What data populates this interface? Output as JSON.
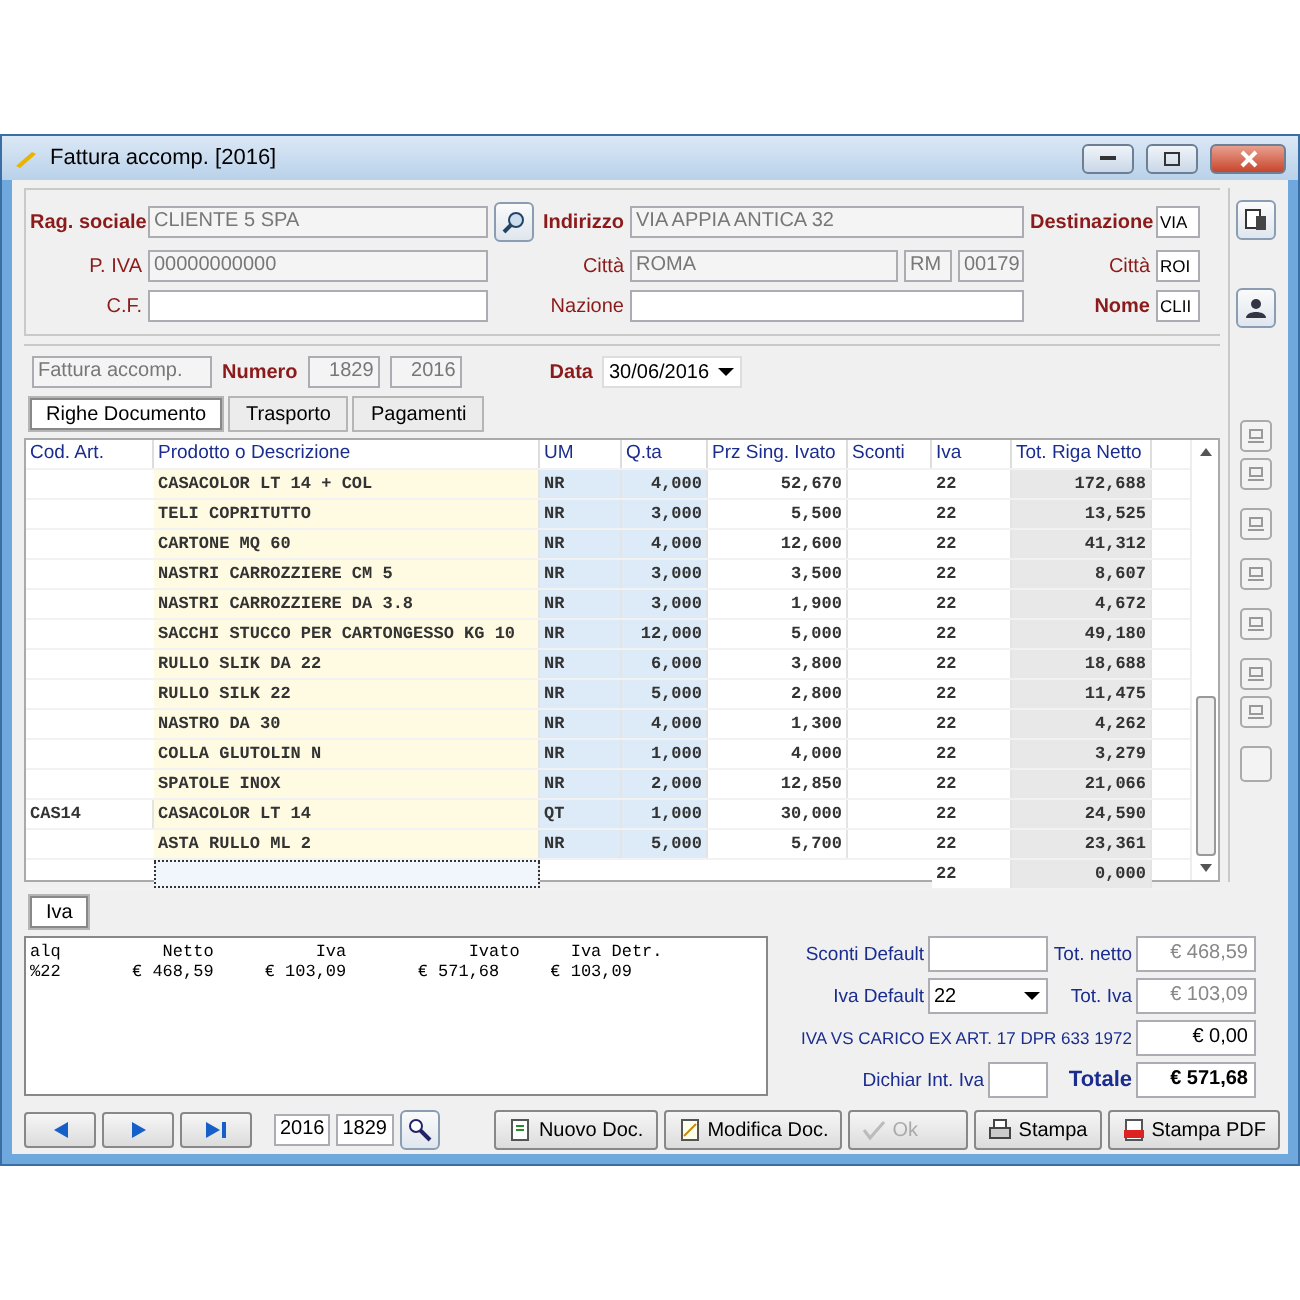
{
  "window": {
    "title": "Fattura accomp. [2016]"
  },
  "customer": {
    "ragione_label": "Rag. sociale",
    "ragione": "CLIENTE 5 SPA",
    "piva_label": "P. IVA",
    "piva": "00000000000",
    "cf_label": "C.F.",
    "indirizzo_label": "Indirizzo",
    "indirizzo": "VIA APPIA ANTICA 32",
    "citta_label": "Città",
    "citta": "ROMA",
    "prov": "RM",
    "cap": "00179",
    "nazione_label": "Nazione",
    "dest_label": "Destinazione",
    "dest": "VIA",
    "dest_citta_label": "Città",
    "dest_citta": "ROI",
    "nome_label": "Nome",
    "nome": "CLII"
  },
  "document": {
    "type": "Fattura accomp.",
    "numero_label": "Numero",
    "numero": "1829",
    "anno": "2016",
    "data_label": "Data",
    "data": "30/06/2016"
  },
  "tabs": [
    {
      "label": "Righe Documento",
      "selected": true
    },
    {
      "label": "Trasporto",
      "selected": false
    },
    {
      "label": "Pagamenti",
      "selected": false
    }
  ],
  "table": {
    "columns": [
      "Cod. Art.",
      "Prodotto o Descrizione",
      "UM",
      "Q.ta",
      "Prz Sing. Ivato",
      "Sconti",
      "Iva",
      "Tot. Riga Netto"
    ],
    "rows": [
      {
        "cells": [
          "",
          "CASACOLOR LT 14 + COL",
          "NR",
          "4,000",
          "52,670",
          "",
          "22",
          "172,688"
        ],
        "current": false
      },
      {
        "cells": [
          "",
          "TELI COPRITUTTO",
          "NR",
          "3,000",
          "5,500",
          "",
          "22",
          "13,525"
        ],
        "current": false
      },
      {
        "cells": [
          "",
          "CARTONE MQ 60",
          "NR",
          "4,000",
          "12,600",
          "",
          "22",
          "41,312"
        ],
        "current": false
      },
      {
        "cells": [
          "",
          "NASTRI CARROZZIERE CM 5",
          "NR",
          "3,000",
          "3,500",
          "",
          "22",
          "8,607"
        ],
        "current": false
      },
      {
        "cells": [
          "",
          "NASTRI CARROZZIERE DA 3.8",
          "NR",
          "3,000",
          "1,900",
          "",
          "22",
          "4,672"
        ],
        "current": false
      },
      {
        "cells": [
          "",
          "SACCHI STUCCO PER CARTONGESSO KG 10",
          "NR",
          "12,000",
          "5,000",
          "",
          "22",
          "49,180"
        ],
        "current": false
      },
      {
        "cells": [
          "",
          "RULLO SLIK DA 22",
          "NR",
          "6,000",
          "3,800",
          "",
          "22",
          "18,688"
        ],
        "current": false
      },
      {
        "cells": [
          "",
          "RULLO SILK 22",
          "NR",
          "5,000",
          "2,800",
          "",
          "22",
          "11,475"
        ],
        "current": false
      },
      {
        "cells": [
          "",
          "NASTRO DA 30",
          "NR",
          "4,000",
          "1,300",
          "",
          "22",
          "4,262"
        ],
        "current": false
      },
      {
        "cells": [
          "",
          "COLLA GLUTOLIN N",
          "NR",
          "1,000",
          "4,000",
          "",
          "22",
          "3,279"
        ],
        "current": false
      },
      {
        "cells": [
          "",
          "SPATOLE INOX",
          "NR",
          "2,000",
          "12,850",
          "",
          "22",
          "21,066"
        ],
        "current": false
      },
      {
        "cells": [
          "CAS14",
          "CASACOLOR LT 14",
          "QT",
          "1,000",
          "30,000",
          "",
          "22",
          "24,590"
        ],
        "current": false
      },
      {
        "cells": [
          "",
          "ASTA RULLO ML 2",
          "NR",
          "5,000",
          "5,700",
          "",
          "22",
          "23,361"
        ],
        "current": false
      },
      {
        "cells": [
          "",
          "",
          "",
          "",
          "",
          "",
          "22",
          "0,000"
        ],
        "current": true
      }
    ]
  },
  "iva_tab": {
    "label": "Iva",
    "selected": true
  },
  "iva_summary": [
    "alq          Netto          Iva            Ivato     Iva Detr.",
    "%22       € 468,59     € 103,09       € 571,68     € 103,09"
  ],
  "totals": {
    "sconti_label": "Sconti Default",
    "iva_default_label": "Iva Default",
    "iva_default": "22",
    "iva_carico_label": "IVA VS CARICO EX ART. 17 DPR 633 1972",
    "iva_carico": "€ 0,00",
    "dichiar_label": "Dichiar Int. Iva",
    "tot_netto_label": "Tot. netto",
    "tot_netto": "€ 468,59",
    "tot_iva_label": "Tot. Iva",
    "tot_iva": "€ 103,09",
    "totale_label": "Totale",
    "totale": "€ 571,68"
  },
  "nav": {
    "anno": "2016",
    "numero": "1829"
  },
  "buttons": [
    {
      "label": "Nuovo Doc.",
      "kind": "new",
      "disabled": false
    },
    {
      "label": "Modifica Doc.",
      "kind": "edit",
      "disabled": false
    },
    {
      "label": "Ok",
      "kind": "ok",
      "disabled": true
    },
    {
      "label": "Stampa",
      "kind": "print",
      "disabled": false
    },
    {
      "label": "Stampa PDF",
      "kind": "pdf",
      "disabled": false
    }
  ]
}
